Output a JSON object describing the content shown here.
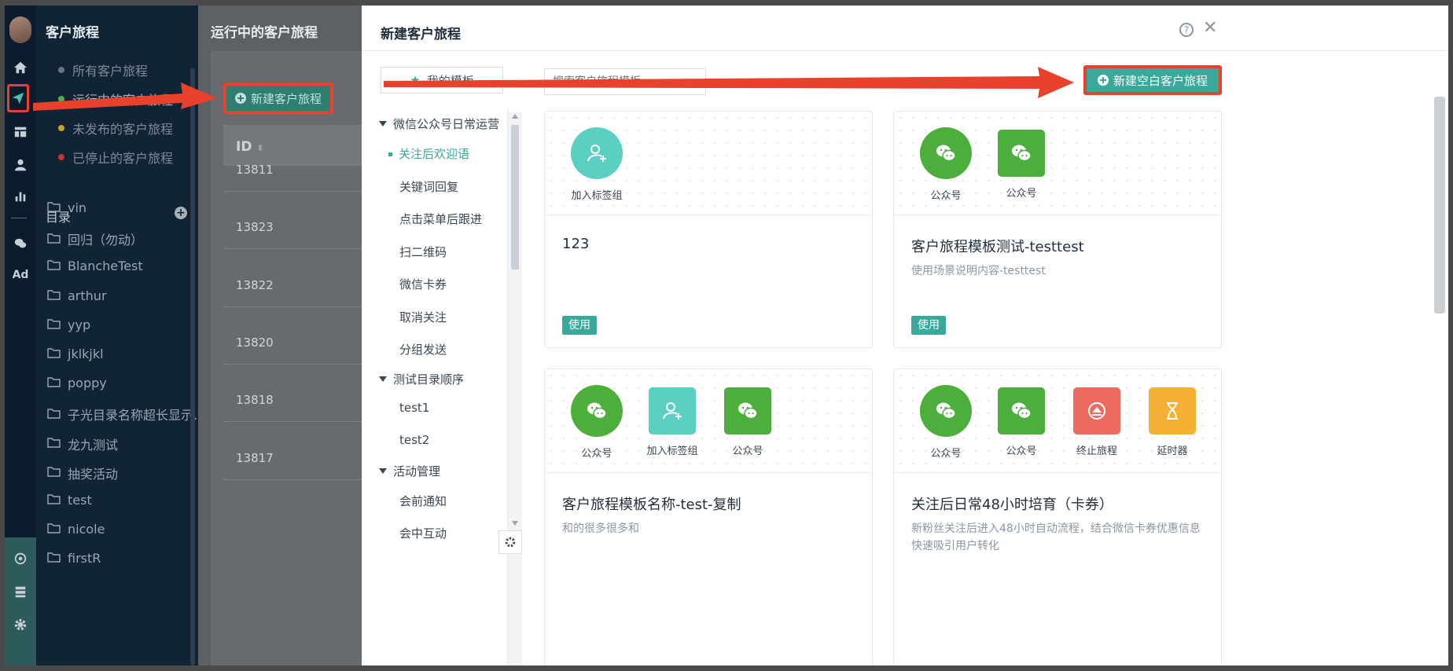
{
  "sidebar": {
    "title": "客户旅程",
    "status_items": [
      {
        "label": "所有客户旅程",
        "color": "#6b7580"
      },
      {
        "label": "运行中的客户旅程",
        "color": "#4caf50"
      },
      {
        "label": "未发布的客户旅程",
        "color": "#c9a227"
      },
      {
        "label": "已停止的客户旅程",
        "color": "#c0392b"
      }
    ],
    "catalog_label": "目录",
    "folders": [
      "vin",
      "回归（勿动）",
      "BlancheTest",
      "arthur",
      "yyp",
      "jklkjkl",
      "poppy",
      "子光目录名称超长显示...",
      "龙九测试",
      "抽奖活动",
      "test",
      "nicole",
      "firstR"
    ]
  },
  "iconbar": {
    "ad_label": "Ad"
  },
  "content": {
    "title": "运行中的客户旅程",
    "new_button": "新建客户旅程",
    "id_header": "ID",
    "ids": [
      "13811",
      "13823",
      "13822",
      "13820",
      "13818",
      "13817"
    ]
  },
  "modal": {
    "title": "新建客户旅程",
    "help": "?",
    "close": "✕",
    "my_templates": "我的模板",
    "search_placeholder": "搜索客户旅程模板",
    "new_blank": "新建空白客户旅程",
    "tree": [
      {
        "group": "微信公众号日常运营",
        "items": [
          "关注后欢迎语",
          "关键词回复",
          "点击菜单后跟进",
          "扫二维码",
          "微信卡券",
          "取消关注",
          "分组发送"
        ],
        "selected": "关注后欢迎语"
      },
      {
        "group": "测试目录顺序",
        "items": [
          "test1",
          "test2"
        ]
      },
      {
        "group": "活动管理",
        "items": [
          "会前通知",
          "会中互动"
        ]
      }
    ],
    "cards": [
      {
        "nodes": [
          {
            "label": "加入标签组",
            "kind": "tag"
          }
        ],
        "name": "123",
        "desc": "",
        "use": "使用"
      },
      {
        "nodes": [
          {
            "label": "公众号",
            "kind": "wechat-round"
          },
          {
            "label": "公众号",
            "kind": "wechat-sq"
          }
        ],
        "name": "客户旅程模板测试-testtest",
        "desc": "使用场景说明内容-testtest",
        "use": "使用"
      },
      {
        "nodes": [
          {
            "label": "公众号",
            "kind": "wechat-round"
          },
          {
            "label": "加入标签组",
            "kind": "tag-sq"
          },
          {
            "label": "公众号",
            "kind": "wechat-sq"
          }
        ],
        "name": "客户旅程模板名称-test-复制",
        "desc": "和的很多很多和",
        "use": ""
      },
      {
        "nodes": [
          {
            "label": "公众号",
            "kind": "wechat-round"
          },
          {
            "label": "公众号",
            "kind": "wechat-sq"
          },
          {
            "label": "终止旅程",
            "kind": "stop"
          },
          {
            "label": "延时器",
            "kind": "timer"
          }
        ],
        "name": "关注后日常48小时培育（卡券）",
        "desc": "新粉丝关注后进入48小时自动流程，结合微信卡券优惠信息快速吸引用户转化",
        "use": ""
      }
    ]
  },
  "colors": {
    "accent": "#3aa99b",
    "highlight": "#e8412c",
    "wechat": "#4caf3c",
    "tag": "#5ccfc3",
    "stop": "#ec6a5e",
    "timer": "#f4b136"
  }
}
